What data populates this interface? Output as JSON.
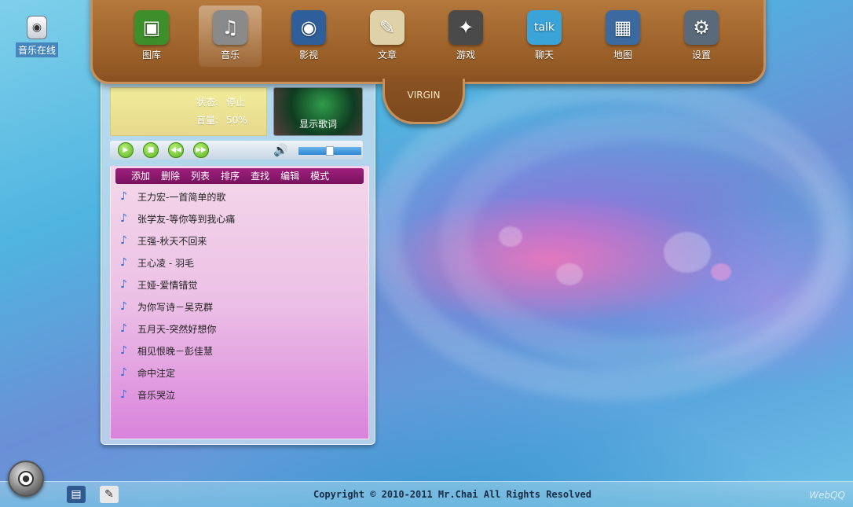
{
  "desktop": {
    "icons": [
      {
        "label": "音乐在线",
        "icon": "speaker-icon"
      }
    ]
  },
  "dock": {
    "items": [
      {
        "label": "图库",
        "icon": "gallery-icon",
        "glyph": "▣",
        "bg": "#3d8f2c"
      },
      {
        "label": "音乐",
        "icon": "music-icon",
        "glyph": "♫",
        "bg": "#8a8a8a",
        "active": true
      },
      {
        "label": "影视",
        "icon": "film-reel-icon",
        "glyph": "◉",
        "bg": "#2e5f9a"
      },
      {
        "label": "文章",
        "icon": "document-icon",
        "glyph": "✎",
        "bg": "#e0d2a8"
      },
      {
        "label": "游戏",
        "icon": "gamepad-icon",
        "glyph": "✦",
        "bg": "#4a4a4a"
      },
      {
        "label": "聊天",
        "icon": "talk-icon",
        "glyph": "talk",
        "bg": "#3aa3d8"
      },
      {
        "label": "地图",
        "icon": "map-icon",
        "glyph": "▦",
        "bg": "#3b6aa0"
      },
      {
        "label": "设置",
        "icon": "settings-gear-icon",
        "glyph": "⚙",
        "bg": "#5a6a7a"
      }
    ],
    "tab_label": "VIRGIN"
  },
  "player": {
    "status_label": "状态:",
    "status_value": "停止",
    "volume_label": "音量:",
    "volume_value": "50%",
    "volume_level": 0.5,
    "lyrics_button": "显示歌词",
    "menu": [
      "添加",
      "删除",
      "列表",
      "排序",
      "查找",
      "编辑",
      "模式"
    ],
    "tracks": [
      "王力宏-一首简单的歌",
      "张学友-等你等到我心痛",
      "王强-秋天不回来",
      "王心凌 - 羽毛",
      "王娅-爱情错觉",
      "为你写诗－吴克群",
      "五月天-突然好想你",
      "相见恨晚－彭佳慧",
      "命中注定",
      "音乐哭泣"
    ]
  },
  "footer": {
    "copyright": "Copyright © 2010-2011 Mr.Chai All Rights Resolved",
    "brand": "WebQQ"
  },
  "colors": {
    "dock": "#9a5f28",
    "menu": "#8a1a6e",
    "accent_green": "#57b21e"
  }
}
